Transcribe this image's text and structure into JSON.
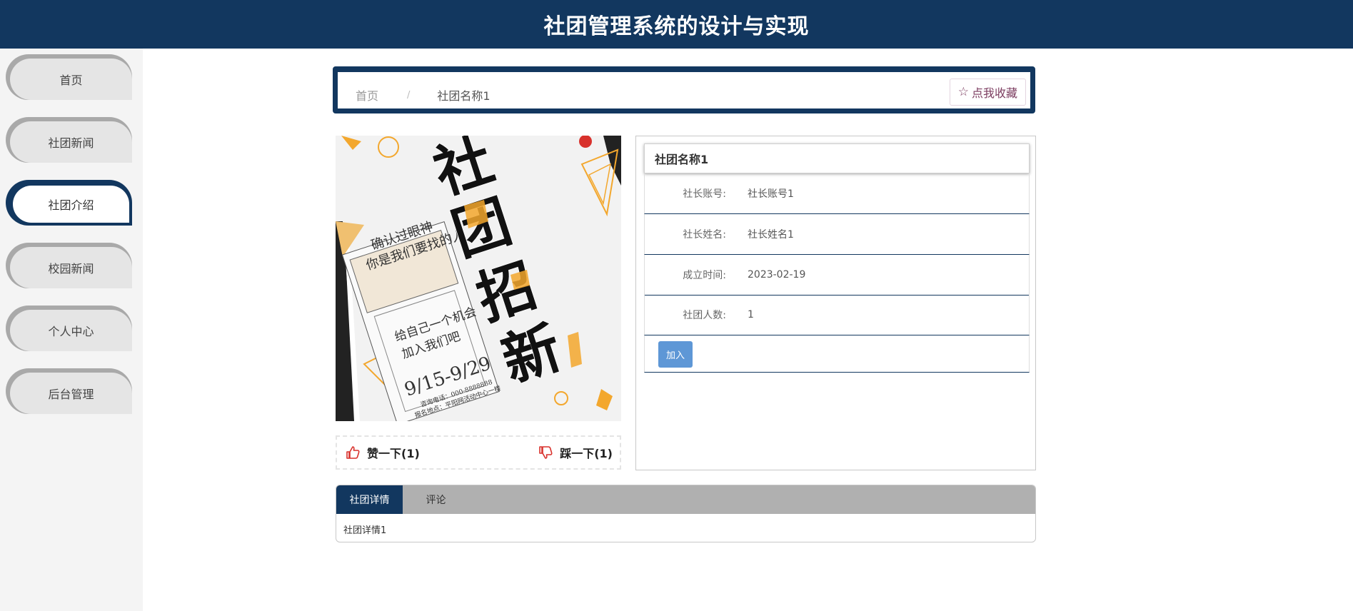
{
  "header": {
    "title": "社团管理系统的设计与实现"
  },
  "sidebar": {
    "items": [
      {
        "label": "首页"
      },
      {
        "label": "社团新闻"
      },
      {
        "label": "社团介绍",
        "active": true
      },
      {
        "label": "校园新闻"
      },
      {
        "label": "个人中心"
      },
      {
        "label": "后台管理"
      }
    ]
  },
  "breadcrumb": {
    "home": "首页",
    "separator": "/",
    "current": "社团名称1"
  },
  "favorite": {
    "label": "点我收藏",
    "icon": "star-icon"
  },
  "poster": {
    "big_chars": [
      "社",
      "团",
      "招",
      "新"
    ],
    "line1": "确认过眼神",
    "line2": "你是我们要找的人",
    "line3": "给自己一个机会",
    "line4": "加入我们吧",
    "dates": "9/15-9/29",
    "contact1": "咨询电话：000-8888888",
    "contact2": "报名地点：平阳网活动中心一楼"
  },
  "votes": {
    "up_label": "赞一下(1)",
    "down_label": "踩一下(1)"
  },
  "info": {
    "name": "社团名称1",
    "rows": [
      {
        "label": "社长账号:",
        "value": "社长账号1"
      },
      {
        "label": "社长姓名:",
        "value": "社长姓名1"
      },
      {
        "label": "成立时间:",
        "value": "2023-02-19"
      },
      {
        "label": "社团人数:",
        "value": "1"
      }
    ],
    "join_label": "加入"
  },
  "tabs": {
    "items": [
      {
        "label": "社团详情",
        "active": true
      },
      {
        "label": "评论"
      }
    ],
    "content": "社团详情1"
  },
  "colors": {
    "primary": "#12375f",
    "join": "#5e97d6",
    "accent": "#f3a72d"
  }
}
